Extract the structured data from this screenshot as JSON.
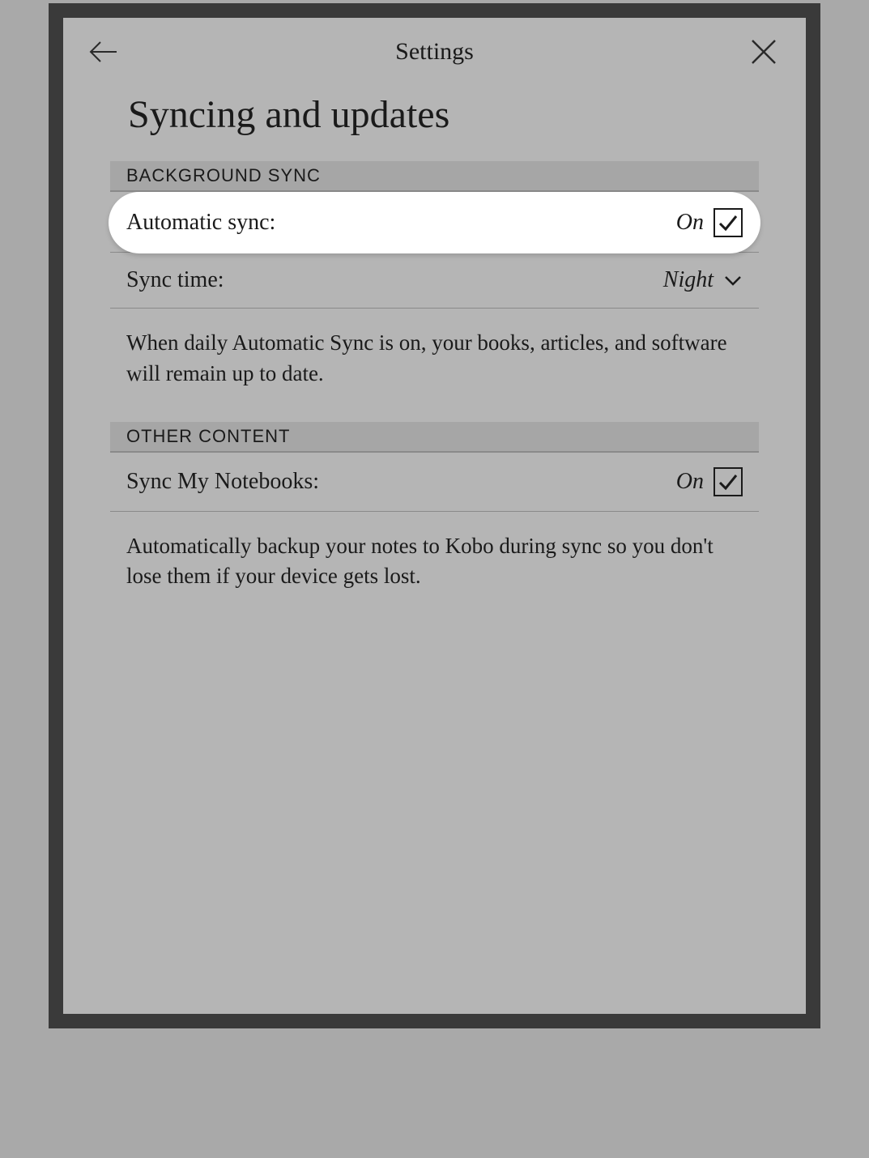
{
  "header": {
    "title": "Settings"
  },
  "page": {
    "title": "Syncing and updates"
  },
  "sections": {
    "background_sync": {
      "header": "BACKGROUND SYNC",
      "automatic_sync": {
        "label": "Automatic sync:",
        "value": "On"
      },
      "sync_time": {
        "label": "Sync time:",
        "value": "Night"
      },
      "description": "When daily Automatic Sync is on, your books, articles, and software will remain up to date."
    },
    "other_content": {
      "header": "OTHER CONTENT",
      "sync_notebooks": {
        "label": "Sync My Notebooks:",
        "value": "On"
      },
      "description": "Automatically backup your notes to Kobo during sync so you don't lose them if your device gets lost."
    }
  }
}
